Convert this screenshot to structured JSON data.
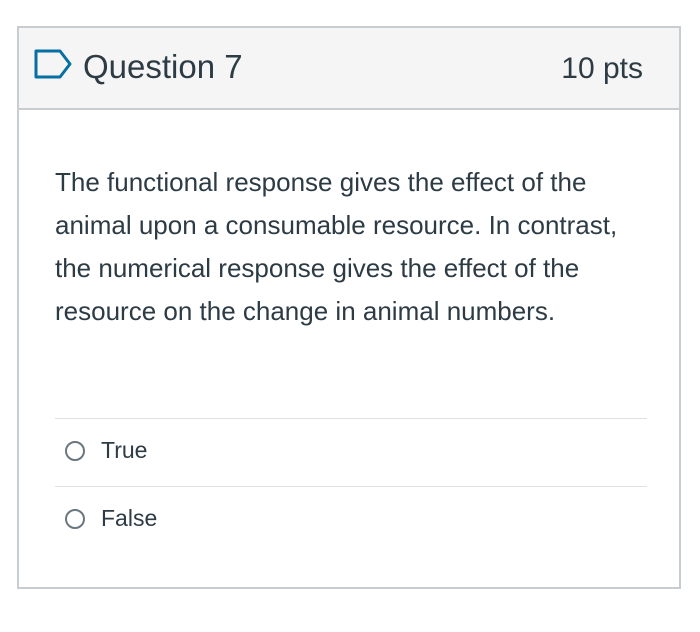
{
  "question": {
    "title": "Question 7",
    "points": "10 pts",
    "text": "The functional response gives the effect of the animal upon a consumable resource. In contrast, the numerical response gives the effect of the resource on the change in animal numbers.",
    "flag_icon": "flag-outline-icon",
    "answers": [
      {
        "label": "True",
        "selected": false
      },
      {
        "label": "False",
        "selected": false
      }
    ]
  },
  "colors": {
    "text": "#2d3b45",
    "header_bg": "#f5f5f5",
    "border": "#c7cdd1",
    "flag": "#0770a3"
  }
}
